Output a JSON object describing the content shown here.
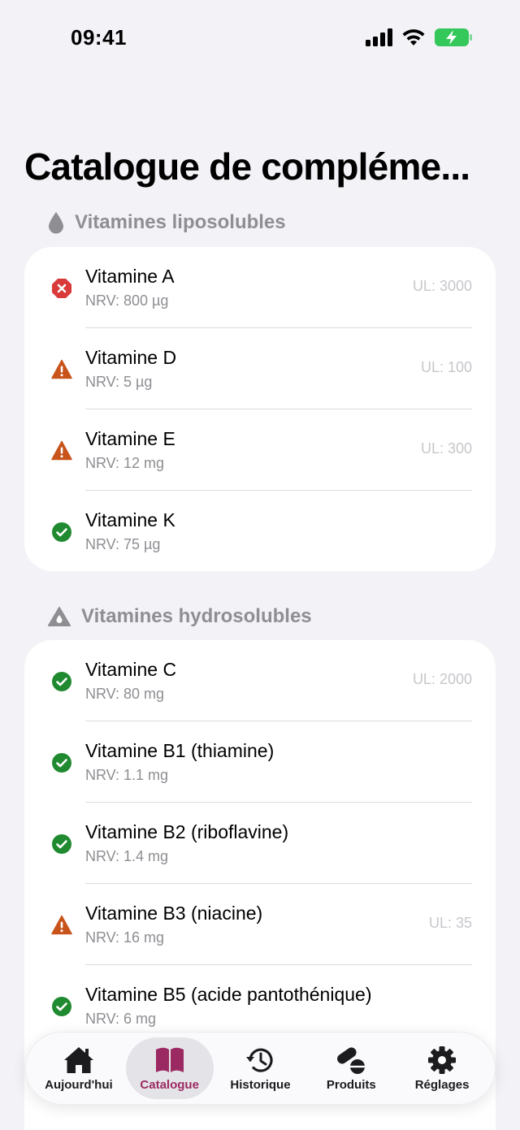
{
  "status_bar": {
    "time": "09:41"
  },
  "title": "Catalogue de compléme...",
  "sections": [
    {
      "header": "Vitamines liposolubles",
      "icon": "drop-icon",
      "items": [
        {
          "name": "Vitamine A",
          "nrv": "NRV: 800 µg",
          "ul": "UL: 3000",
          "status": "error"
        },
        {
          "name": "Vitamine D",
          "nrv": "NRV: 5 µg",
          "ul": "UL: 100",
          "status": "warning"
        },
        {
          "name": "Vitamine E",
          "nrv": "NRV: 12 mg",
          "ul": "UL: 300",
          "status": "warning"
        },
        {
          "name": "Vitamine K",
          "nrv": "NRV: 75 µg",
          "ul": "",
          "status": "ok"
        }
      ]
    },
    {
      "header": "Vitamines hydrosolubles",
      "icon": "drop-triangle-icon",
      "items": [
        {
          "name": "Vitamine C",
          "nrv": "NRV: 80 mg",
          "ul": "UL: 2000",
          "status": "ok"
        },
        {
          "name": "Vitamine B1 (thiamine)",
          "nrv": "NRV: 1.1 mg",
          "ul": "",
          "status": "ok"
        },
        {
          "name": "Vitamine B2 (riboflavine)",
          "nrv": "NRV: 1.4 mg",
          "ul": "",
          "status": "ok"
        },
        {
          "name": "Vitamine B3 (niacine)",
          "nrv": "NRV: 16 mg",
          "ul": "UL: 35",
          "status": "warning"
        },
        {
          "name": "Vitamine B5 (acide pantothénique)",
          "nrv": "NRV: 6 mg",
          "ul": "",
          "status": "ok"
        }
      ]
    }
  ],
  "tabbar": {
    "tabs": [
      {
        "label": "Aujourd'hui",
        "icon": "house-icon",
        "active": false
      },
      {
        "label": "Catalogue",
        "icon": "book-icon",
        "active": true
      },
      {
        "label": "Historique",
        "icon": "clock-history-icon",
        "active": false
      },
      {
        "label": "Produits",
        "icon": "pills-icon",
        "active": false
      },
      {
        "label": "Réglages",
        "icon": "gear-icon",
        "active": false
      }
    ]
  },
  "colors": {
    "error": "#d93a3a",
    "warning": "#c8541b",
    "ok": "#1f8a2f",
    "accent": "#9c2a62"
  }
}
